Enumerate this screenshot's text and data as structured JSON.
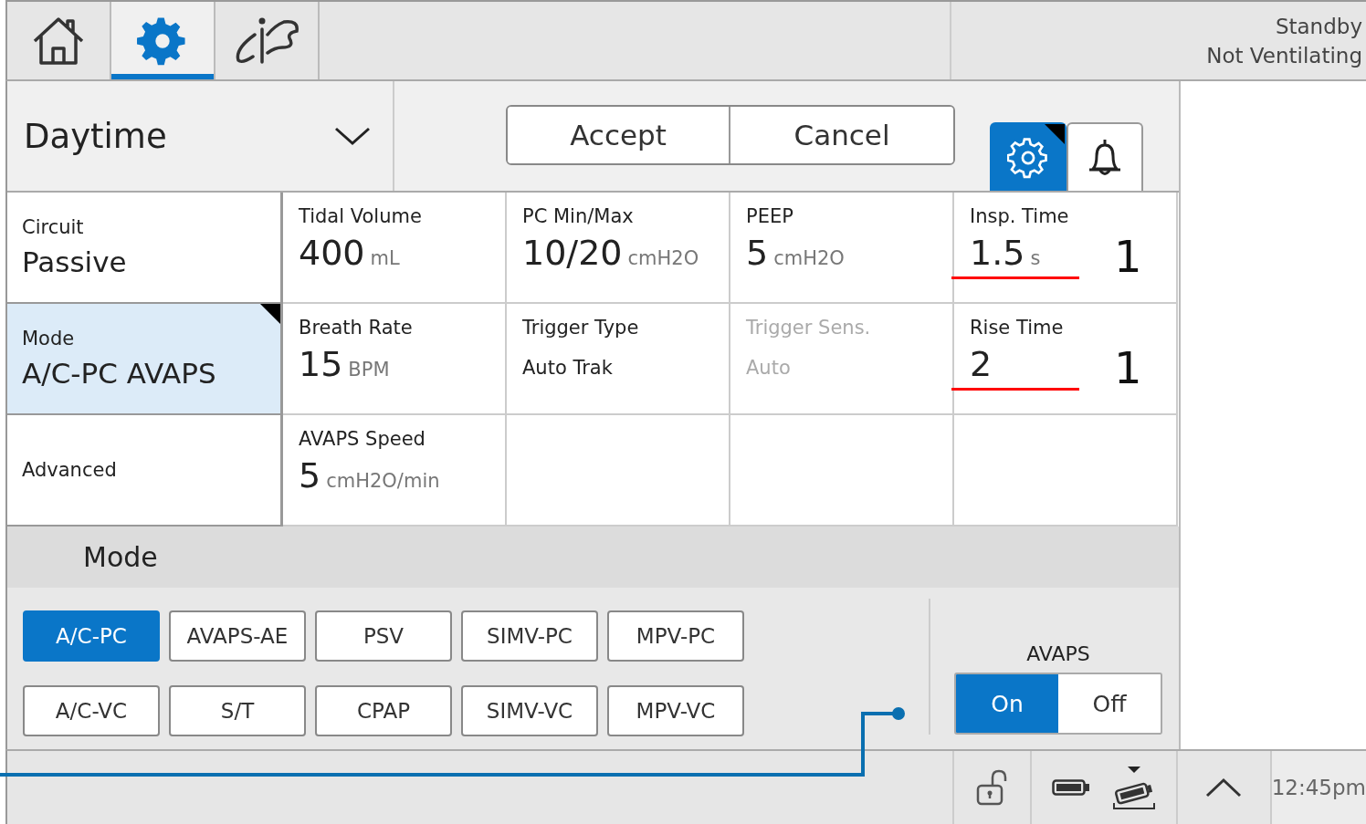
{
  "top_tabs": [
    {
      "kind": "home",
      "selected": false
    },
    {
      "kind": "settings",
      "selected": true
    },
    {
      "kind": "service",
      "selected": false
    }
  ],
  "status": {
    "state": "Standby",
    "detail": "Not Ventilating"
  },
  "preset": {
    "value": "Daytime"
  },
  "actions": [
    "Accept",
    "Cancel"
  ],
  "panel_tabs": [
    {
      "kind": "settings",
      "selected": true,
      "flagged": true
    },
    {
      "kind": "alarms",
      "selected": false,
      "flagged": false
    }
  ],
  "side_items": [
    {
      "label": "Circuit",
      "value": "Passive",
      "selected": false,
      "flagged": false
    },
    {
      "label": "Mode",
      "value": "A/C-PC AVAPS",
      "selected": true,
      "flagged": true
    },
    {
      "label": "Advanced",
      "selected": false,
      "flagged": false
    }
  ],
  "settings": [
    [
      {
        "label": "Tidal Volume",
        "value": "400",
        "unit": "mL",
        "disabled": false,
        "struck": false
      },
      {
        "label": "PC Min/Max",
        "value": "10/20",
        "unit": "cmH2O",
        "disabled": false,
        "struck": false
      },
      {
        "label": "PEEP",
        "value": "5",
        "unit": "cmH2O",
        "disabled": false,
        "struck": false
      },
      {
        "label": "Insp. Time",
        "value": "1.5",
        "unit": "s",
        "disabled": false,
        "struck": true,
        "correction": "1"
      }
    ],
    [
      {
        "label": "Breath Rate",
        "value": "15",
        "unit": "BPM",
        "disabled": false,
        "struck": false
      },
      {
        "label": "Trigger Type",
        "text": "Auto Trak",
        "disabled": false,
        "struck": false
      },
      {
        "label": "Trigger Sens.",
        "text": "Auto",
        "disabled": true,
        "struck": false
      },
      {
        "label": "Rise Time",
        "value": "2",
        "disabled": false,
        "struck": true,
        "correction": "1"
      }
    ],
    [
      {
        "label": "AVAPS Speed",
        "value": "5",
        "unit": "cmH2O/min",
        "disabled": false,
        "struck": false
      }
    ]
  ],
  "mode": {
    "title": "Mode",
    "options": [
      {
        "label": "A/C-PC",
        "selected": true
      },
      {
        "label": "AVAPS-AE",
        "selected": false
      },
      {
        "label": "PSV",
        "selected": false
      },
      {
        "label": "SIMV-PC",
        "selected": false
      },
      {
        "label": "MPV-PC",
        "selected": false
      },
      {
        "label": "A/C-VC",
        "selected": false
      },
      {
        "label": "S/T",
        "selected": false
      },
      {
        "label": "CPAP",
        "selected": false
      },
      {
        "label": "SIMV-VC",
        "selected": false
      },
      {
        "label": "MPV-VC",
        "selected": false
      }
    ],
    "avaps": {
      "label": "AVAPS",
      "options": [
        {
          "label": "On",
          "selected": true
        },
        {
          "label": "Off",
          "selected": false
        }
      ]
    }
  },
  "footer": {
    "locked": false,
    "time": "12:45pm"
  }
}
